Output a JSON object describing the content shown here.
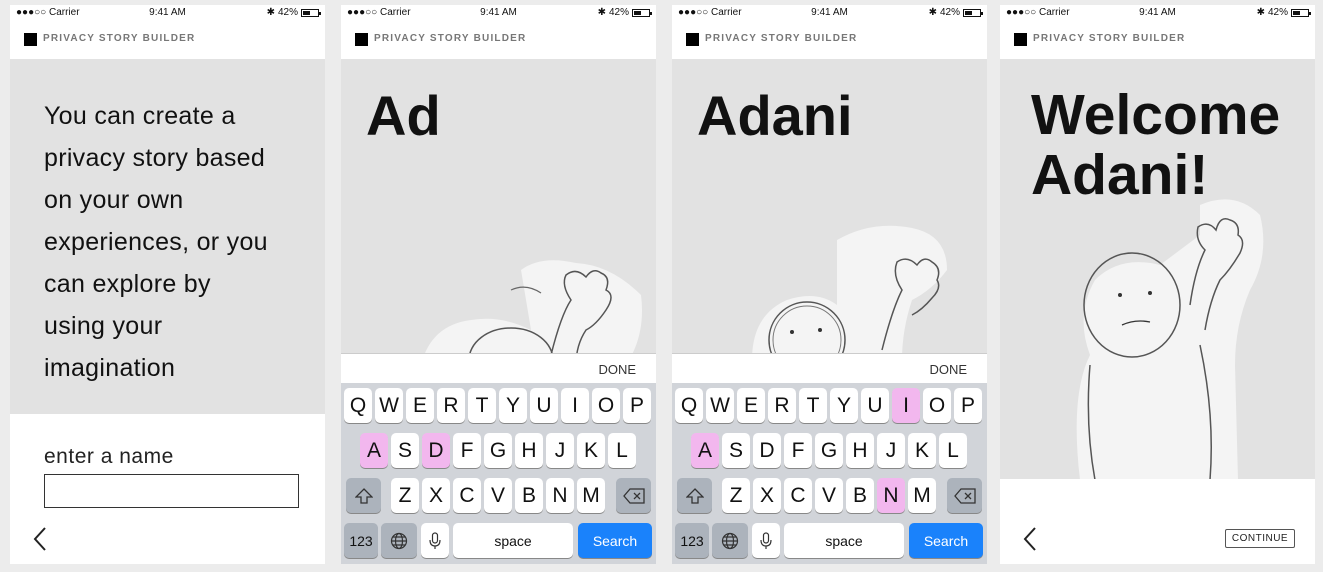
{
  "status": {
    "carrier": "●●●○○ Carrier",
    "time": "9:41 AM",
    "battery": "42%"
  },
  "app_title": "PRIVACY STORY BUILDER",
  "screen1": {
    "intro_lines": [
      "You can create a",
      "privacy story based",
      "on your own",
      "experiences, or you",
      "can explore by",
      "using your",
      "imagination"
    ],
    "enter_label": "enter a name",
    "input_value": ""
  },
  "screen2": {
    "typed": "Ad",
    "done": "DONE",
    "highlighted_keys": [
      "A",
      "D"
    ]
  },
  "screen3": {
    "typed": "Adani",
    "done": "DONE",
    "highlighted_keys": [
      "I",
      "A",
      "N"
    ]
  },
  "screen4": {
    "welcome_line1": "Welcome",
    "welcome_line2": "Adani!",
    "continue": "CONTINUE"
  },
  "keyboard": {
    "row1": [
      "Q",
      "W",
      "E",
      "R",
      "T",
      "Y",
      "U",
      "I",
      "O",
      "P"
    ],
    "row2": [
      "A",
      "S",
      "D",
      "F",
      "G",
      "H",
      "J",
      "K",
      "L"
    ],
    "row3": [
      "Z",
      "X",
      "C",
      "V",
      "B",
      "N",
      "M"
    ],
    "numbers": "123",
    "space": "space",
    "search": "Search",
    "icons": [
      "shift-icon",
      "delete-icon",
      "globe-icon",
      "microphone-icon"
    ]
  },
  "colors": {
    "highlight": "#f2b7ee",
    "search": "#1a82fb",
    "background": "#e2e2e2"
  }
}
